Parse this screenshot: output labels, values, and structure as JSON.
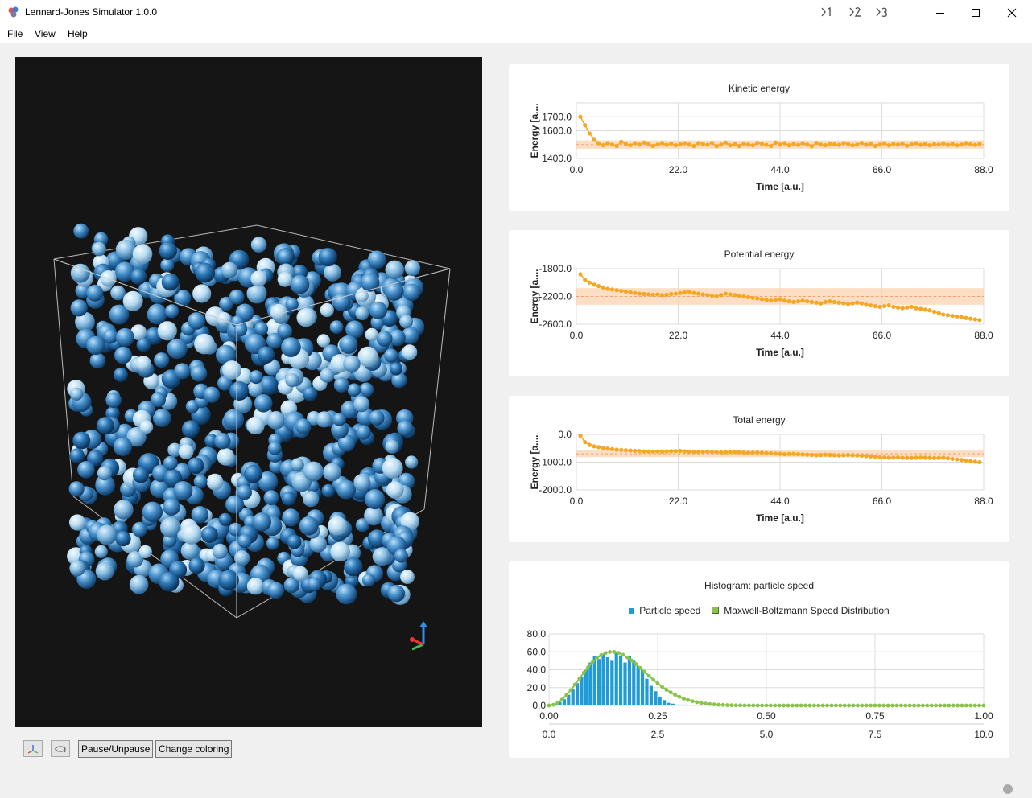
{
  "window": {
    "title": "Lennard-Jones Simulator 1.0.0"
  },
  "menu": {
    "file": "File",
    "view": "View",
    "help": "Help"
  },
  "toolbar": {
    "pause_label": "Pause/Unpause",
    "coloring_label": "Change coloring"
  },
  "colors": {
    "series": "#f5a623",
    "band": "#fbd3b0",
    "histogram": "#1f9bd6",
    "maxwell": "#8ac34a",
    "viewport_bg": "#151515"
  },
  "charts": {
    "kinetic": {
      "type": "line",
      "title": "Kinetic energy",
      "xlabel": "Time [a.u.]",
      "ylabel": "Energy [a....",
      "xlim": [
        0,
        88
      ],
      "ylim": [
        1400,
        1800
      ],
      "xticks": [
        "0.0",
        "22.0",
        "44.0",
        "66.0",
        "88.0"
      ],
      "yticks": [
        {
          "v": 1400,
          "l": "1400.0"
        },
        {
          "v": 1600,
          "l": "1600.0"
        },
        {
          "v": 1700,
          "l": "1700.0"
        }
      ],
      "band": [
        1470,
        1530
      ],
      "values": [
        1700,
        1640,
        1580,
        1540,
        1510,
        1495,
        1510,
        1500,
        1490,
        1520,
        1505,
        1495,
        1510,
        1500,
        1515,
        1505,
        1490,
        1500,
        1512,
        1498,
        1508,
        1495,
        1502,
        1510,
        1500,
        1490,
        1510,
        1505,
        1498,
        1512,
        1488,
        1500,
        1515,
        1495,
        1505,
        1490,
        1508,
        1500,
        1495,
        1512,
        1505,
        1498,
        1490,
        1515,
        1500,
        1510,
        1495,
        1505,
        1498,
        1510,
        1500,
        1488,
        1512,
        1500,
        1495,
        1508,
        1502,
        1498,
        1510,
        1505,
        1495,
        1500,
        1512,
        1498,
        1505,
        1490,
        1500,
        1510,
        1495,
        1505,
        1500,
        1508,
        1492,
        1502,
        1510,
        1498,
        1505,
        1495,
        1502,
        1500,
        1508,
        1498,
        1505,
        1495,
        1500,
        1510,
        1502,
        1498,
        1505
      ]
    },
    "potential": {
      "type": "line",
      "title": "Potential energy",
      "xlabel": "Time [a.u.]",
      "ylabel": "Energy [a....",
      "xlim": [
        0,
        88
      ],
      "ylim": [
        -2600,
        -1800
      ],
      "xticks": [
        "0.0",
        "22.0",
        "44.0",
        "66.0",
        "88.0"
      ],
      "yticks": [
        {
          "v": -2600,
          "l": "-2600.0"
        },
        {
          "v": -2200,
          "l": "-2200.0"
        },
        {
          "v": -1800,
          "l": "-1800.0"
        }
      ],
      "band": [
        -2320,
        -2080
      ],
      "values": [
        -1880,
        -1960,
        -2000,
        -2030,
        -2050,
        -2070,
        -2090,
        -2100,
        -2110,
        -2120,
        -2130,
        -2140,
        -2150,
        -2160,
        -2165,
        -2170,
        -2175,
        -2170,
        -2180,
        -2175,
        -2165,
        -2160,
        -2150,
        -2140,
        -2130,
        -2150,
        -2160,
        -2170,
        -2180,
        -2190,
        -2200,
        -2180,
        -2160,
        -2170,
        -2180,
        -2190,
        -2200,
        -2210,
        -2220,
        -2230,
        -2240,
        -2250,
        -2260,
        -2250,
        -2240,
        -2260,
        -2270,
        -2280,
        -2270,
        -2260,
        -2270,
        -2280,
        -2290,
        -2300,
        -2280,
        -2270,
        -2280,
        -2290,
        -2300,
        -2310,
        -2300,
        -2290,
        -2300,
        -2320,
        -2330,
        -2340,
        -2350,
        -2340,
        -2330,
        -2350,
        -2360,
        -2370,
        -2360,
        -2350,
        -2370,
        -2380,
        -2390,
        -2400,
        -2420,
        -2440,
        -2460,
        -2470,
        -2480,
        -2490,
        -2500,
        -2510,
        -2520,
        -2530,
        -2540
      ]
    },
    "total": {
      "type": "line",
      "title": "Total energy",
      "xlabel": "Time [a.u.]",
      "ylabel": "Energy [a....",
      "xlim": [
        0,
        88
      ],
      "ylim": [
        -2000,
        0
      ],
      "xticks": [
        "0.0",
        "22.0",
        "44.0",
        "66.0",
        "88.0"
      ],
      "yticks": [
        {
          "v": -2000,
          "l": "-2000.0"
        },
        {
          "v": -1000,
          "l": "-1000.0"
        },
        {
          "v": 0,
          "l": "0.0"
        }
      ],
      "band": [
        -820,
        -580
      ],
      "values": [
        -50,
        -280,
        -380,
        -430,
        -460,
        -490,
        -510,
        -530,
        -550,
        -560,
        -570,
        -580,
        -590,
        -600,
        -610,
        -615,
        -620,
        -615,
        -620,
        -615,
        -605,
        -600,
        -595,
        -610,
        -620,
        -630,
        -640,
        -630,
        -620,
        -630,
        -640,
        -650,
        -640,
        -630,
        -635,
        -640,
        -650,
        -660,
        -655,
        -650,
        -660,
        -670,
        -680,
        -690,
        -700,
        -710,
        -705,
        -700,
        -710,
        -720,
        -730,
        -740,
        -750,
        -740,
        -730,
        -740,
        -750,
        -760,
        -750,
        -740,
        -750,
        -760,
        -770,
        -780,
        -790,
        -800,
        -820,
        -830,
        -840,
        -835,
        -830,
        -840,
        -845,
        -850,
        -840,
        -835,
        -840,
        -845,
        -850,
        -845,
        -840,
        -860,
        -880,
        -900,
        -920,
        -940,
        -960,
        -980,
        -1000
      ]
    },
    "histogram": {
      "type": "bar",
      "title": "Histogram: particle speed",
      "legend": [
        "Particle speed",
        "Maxwell-Boltzmann Speed Distribution"
      ],
      "legend_position": "top",
      "xlim": [
        0,
        1
      ],
      "ylim": [
        0,
        80
      ],
      "xticks_top": [
        "0.00",
        "0.25",
        "0.50",
        "0.75",
        "1.00"
      ],
      "xticks_bottom": [
        "0.0",
        "2.5",
        "5.0",
        "7.5",
        "10.0"
      ],
      "yticks": [
        {
          "v": 0,
          "l": "0.0"
        },
        {
          "v": 20,
          "l": "20.0"
        },
        {
          "v": 40,
          "l": "40.0"
        },
        {
          "v": 60,
          "l": "60.0"
        },
        {
          "v": 80,
          "l": "80.0"
        }
      ],
      "bin_width": 0.01,
      "bars": [
        1,
        2,
        4,
        7,
        12,
        18,
        25,
        32,
        40,
        48,
        55,
        52,
        58,
        54,
        50,
        60,
        56,
        48,
        55,
        50,
        44,
        40,
        30,
        22,
        16,
        10,
        6,
        3,
        2,
        1,
        1,
        1,
        0,
        0,
        0
      ]
    }
  }
}
